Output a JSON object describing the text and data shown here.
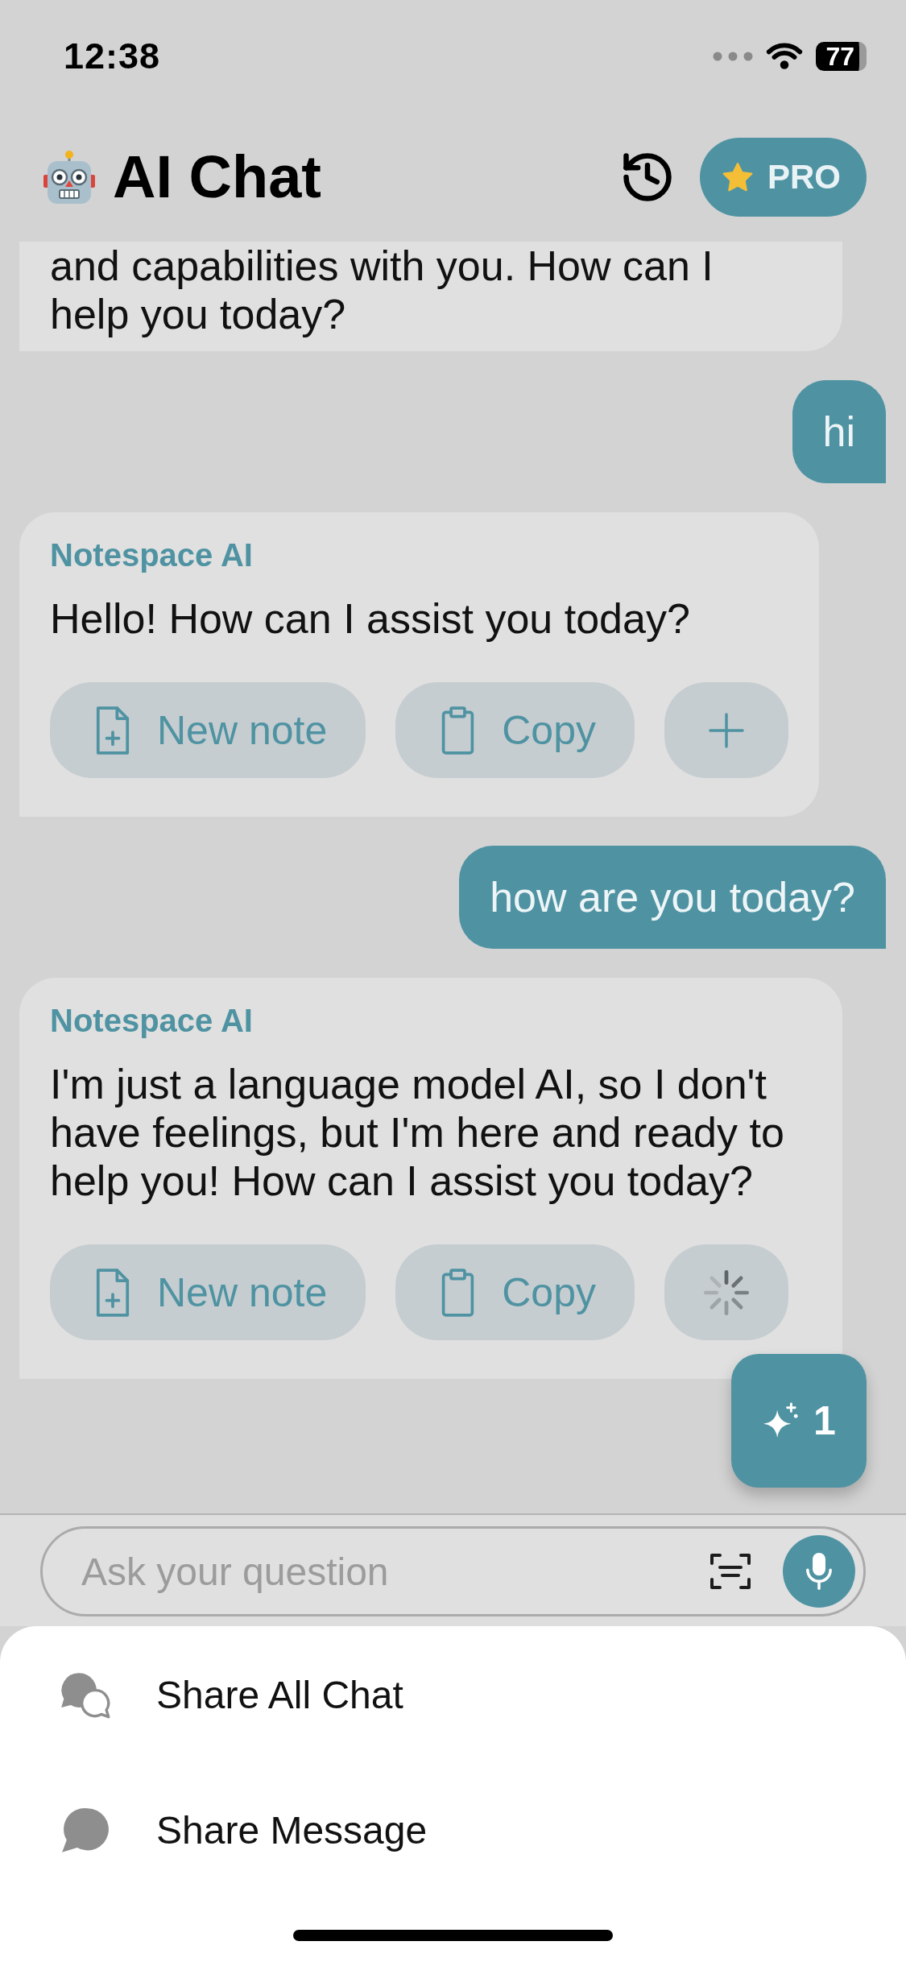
{
  "status_bar": {
    "time": "12:38",
    "battery": "77"
  },
  "header": {
    "title": "AI Chat",
    "pro_label": "PRO"
  },
  "messages": [
    {
      "kind": "ai_partial",
      "text": "and capabilities with you. How can I help you today?"
    },
    {
      "kind": "user",
      "text": "hi"
    },
    {
      "kind": "ai",
      "sender": "Notespace AI",
      "text": "Hello! How can I assist you today?",
      "actions": [
        {
          "kind": "new_note",
          "label": "New note"
        },
        {
          "kind": "copy",
          "label": "Copy"
        },
        {
          "kind": "add"
        }
      ]
    },
    {
      "kind": "user",
      "text": "how are you today?"
    },
    {
      "kind": "ai",
      "sender": "Notespace AI",
      "text": "I'm just a language model AI, so I don't have feelings, but I'm here and ready to help you! How can I assist you today?",
      "actions": [
        {
          "kind": "new_note",
          "label": "New note"
        },
        {
          "kind": "copy",
          "label": "Copy"
        },
        {
          "kind": "loading"
        }
      ]
    }
  ],
  "fab": {
    "count": "1"
  },
  "composer": {
    "placeholder": "Ask your question"
  },
  "share_sheet": {
    "items": [
      {
        "kind": "all_chat",
        "label": "Share All Chat"
      },
      {
        "kind": "message",
        "label": "Share Message"
      }
    ]
  }
}
